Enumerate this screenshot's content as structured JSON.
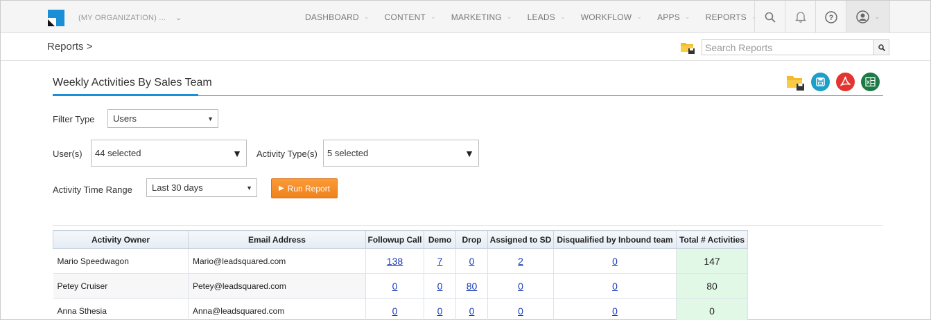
{
  "topbar": {
    "org_name": "(MY ORGANIZATION) ...",
    "nav": [
      {
        "label": "DASHBOARD"
      },
      {
        "label": "CONTENT"
      },
      {
        "label": "MARKETING"
      },
      {
        "label": "LEADS"
      },
      {
        "label": "WORKFLOW"
      },
      {
        "label": "APPS"
      },
      {
        "label": "REPORTS"
      }
    ],
    "icons": [
      "search-icon",
      "bell-icon",
      "help-icon",
      "user-avatar-icon"
    ],
    "brand_color": "#1a8fd6"
  },
  "breadcrumb": {
    "label": "Reports >"
  },
  "search": {
    "placeholder": "Search Reports"
  },
  "report": {
    "title": "Weekly Activities By Sales Team",
    "accent_color": "#1a8fd6",
    "actions": [
      "folder-save-icon",
      "save-icon",
      "pdf-export-icon",
      "excel-export-icon"
    ]
  },
  "filters": {
    "filter_type": {
      "label": "Filter Type",
      "value": "Users"
    },
    "users": {
      "label": "User(s)",
      "value": "44 selected"
    },
    "activity_types": {
      "label": "Activity Type(s)",
      "value": "5 selected"
    },
    "time_range": {
      "label": "Activity Time Range",
      "value": "Last 30 days"
    },
    "run_button": "Run Report",
    "run_color": "#f68b24"
  },
  "table": {
    "columns": [
      "Activity Owner",
      "Email Address",
      "Followup Call",
      "Demo",
      "Drop",
      "Assigned to SD",
      "Disqualified by Inbound team",
      "Total # Activities"
    ],
    "rows": [
      {
        "owner": "Mario Speedwagon",
        "email": "Mario@leadsquared.com",
        "followup": "138",
        "demo": "7",
        "drop": "0",
        "assigned": "2",
        "disqualified": "0",
        "total": "147"
      },
      {
        "owner": "Petey Cruiser",
        "email": "Petey@leadsquared.com",
        "followup": "0",
        "demo": "0",
        "drop": "80",
        "assigned": "0",
        "disqualified": "0",
        "total": "80"
      },
      {
        "owner": "Anna Sthesia",
        "email": "Anna@leadsquared.com",
        "followup": "0",
        "demo": "0",
        "drop": "0",
        "assigned": "0",
        "disqualified": "0",
        "total": "0"
      }
    ],
    "total_color": "#e2f8e6"
  }
}
